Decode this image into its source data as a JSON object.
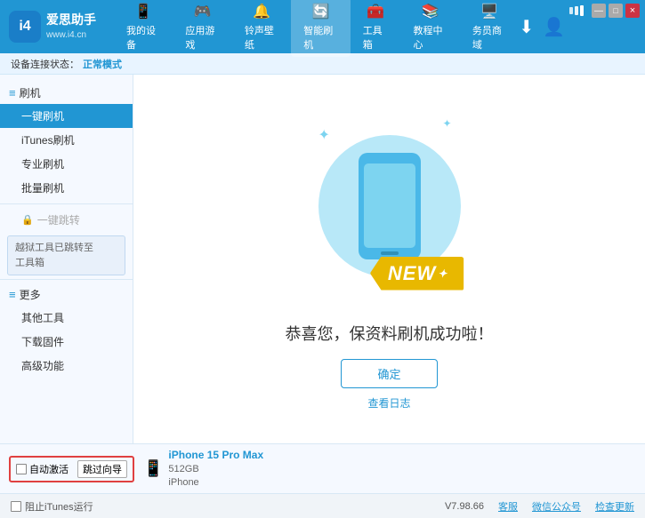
{
  "app": {
    "logo_text": "爱思助手",
    "logo_subtext": "www.i4.cn"
  },
  "nav": {
    "items": [
      {
        "id": "my-device",
        "icon": "📱",
        "label": "我的设备"
      },
      {
        "id": "apps-games",
        "icon": "👤",
        "label": "应用游戏"
      },
      {
        "id": "ringtone",
        "icon": "🔔",
        "label": "铃声壁纸"
      },
      {
        "id": "smart-flash",
        "icon": "🔄",
        "label": "智能刷机",
        "active": true
      },
      {
        "id": "toolbox",
        "icon": "🧰",
        "label": "工具箱"
      },
      {
        "id": "tutorial",
        "icon": "🎓",
        "label": "教程中心"
      },
      {
        "id": "service",
        "icon": "🖥️",
        "label": "务员商域"
      }
    ]
  },
  "status": {
    "prefix": "设备连接状态：",
    "mode": "正常模式"
  },
  "sidebar": {
    "flash_section": "刷机",
    "items": [
      {
        "id": "one-key-flash",
        "label": "一键刷机",
        "active": true
      },
      {
        "id": "itunes-flash",
        "label": "iTunes刷机"
      },
      {
        "id": "pro-flash",
        "label": "专业刷机"
      },
      {
        "id": "batch-flash",
        "label": "批量刷机"
      }
    ],
    "one_key_restore": "一键跳转",
    "restore_note_line1": "越狱工具已跳转至",
    "restore_note_line2": "工具箱",
    "more_section": "更多",
    "more_items": [
      {
        "id": "other-tools",
        "label": "其他工具"
      },
      {
        "id": "download-firmware",
        "label": "下载固件"
      },
      {
        "id": "advanced",
        "label": "高级功能"
      }
    ]
  },
  "content": {
    "new_label": "NEW",
    "success_text": "恭喜您，保资料刷机成功啦！",
    "confirm_button": "确定",
    "view_log": "查看日志"
  },
  "bottom": {
    "auto_activate_label": "自动激活",
    "skip_guide_label": "跳过向导",
    "device_icon": "📱",
    "device_name": "iPhone 15 Pro Max",
    "device_storage": "512GB",
    "device_type": "iPhone"
  },
  "footer": {
    "itunes_label": "阻止iTunes运行",
    "version": "V7.98.66",
    "links": [
      "客服",
      "微信公众号",
      "检查更新"
    ]
  },
  "window_controls": {
    "minimize": "—",
    "restore": "□",
    "close": "×"
  }
}
